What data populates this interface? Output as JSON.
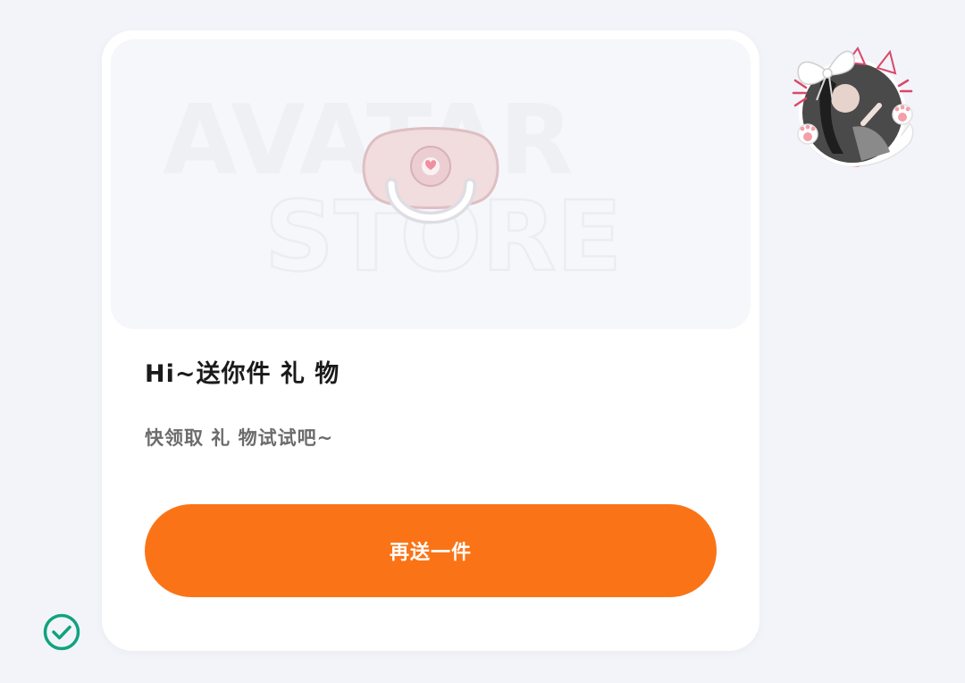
{
  "banner": {
    "watermark_line1": "AVATAR",
    "watermark_line2": "STORE",
    "item_icon": "pacifier-icon"
  },
  "gift": {
    "title": "Hi~送你件 礼 物",
    "subtitle": "快领取 礼 物试试吧~",
    "button_label": "再送一件"
  },
  "avatar": {
    "icon": "avatar-with-cat-ears-frame"
  },
  "status": {
    "icon": "check-circle-icon"
  },
  "colors": {
    "accent": "#fa7417",
    "check": "#10a37f",
    "background": "#f3f4f9",
    "card": "#ffffff"
  }
}
